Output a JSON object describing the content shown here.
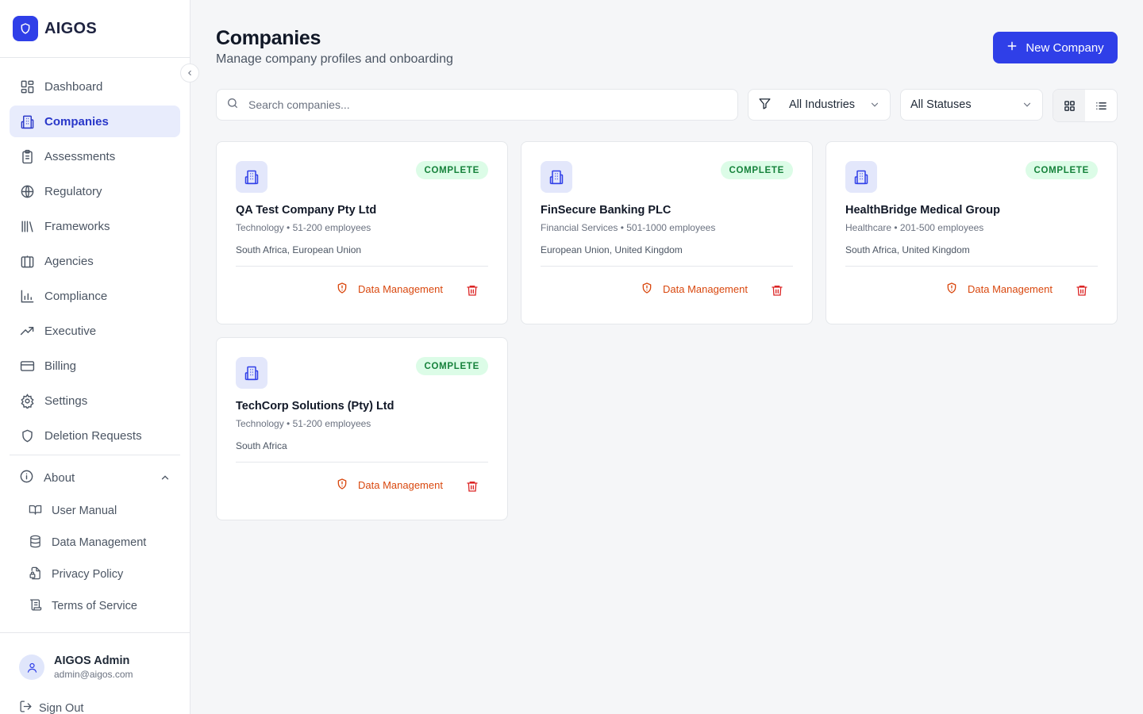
{
  "brand": {
    "name": "AIGOS",
    "color": "#2f3fe8"
  },
  "sidebar": {
    "items": [
      {
        "label": "Dashboard",
        "icon": "dashboard-icon"
      },
      {
        "label": "Companies",
        "icon": "building-icon",
        "active": true
      },
      {
        "label": "Assessments",
        "icon": "clipboard-icon"
      },
      {
        "label": "Regulatory",
        "icon": "globe-icon"
      },
      {
        "label": "Frameworks",
        "icon": "library-icon"
      },
      {
        "label": "Agencies",
        "icon": "landmark-icon"
      },
      {
        "label": "Compliance",
        "icon": "bar-chart-icon"
      },
      {
        "label": "Executive",
        "icon": "trending-up-icon"
      },
      {
        "label": "Billing",
        "icon": "credit-card-icon"
      },
      {
        "label": "Settings",
        "icon": "gear-icon"
      },
      {
        "label": "Deletion Requests",
        "icon": "shield-icon"
      }
    ],
    "about": {
      "label": "About",
      "items": [
        {
          "label": "User Manual",
          "icon": "book-icon"
        },
        {
          "label": "Data Management",
          "icon": "database-icon"
        },
        {
          "label": "Privacy Policy",
          "icon": "lock-file-icon"
        },
        {
          "label": "Terms of Service",
          "icon": "scroll-icon"
        }
      ]
    },
    "user": {
      "name": "AIGOS Admin",
      "email": "admin@aigos.com"
    },
    "sign_out": "Sign Out"
  },
  "header": {
    "title": "Companies",
    "subtitle": "Manage company profiles and onboarding",
    "new_button": "New Company"
  },
  "filters": {
    "search_placeholder": "Search companies...",
    "industry": "All Industries",
    "status": "All Statuses"
  },
  "companies": [
    {
      "name": "QA Test Company Pty Ltd",
      "meta": "Technology • 51-200 employees",
      "regions": "South Africa, European Union",
      "status": "COMPLETE",
      "action": "Data Management"
    },
    {
      "name": "FinSecure Banking PLC",
      "meta": "Financial Services • 501-1000 employees",
      "regions": "European Union, United Kingdom",
      "status": "COMPLETE",
      "action": "Data Management"
    },
    {
      "name": "HealthBridge Medical Group",
      "meta": "Healthcare • 201-500 employees",
      "regions": "South Africa, United Kingdom",
      "status": "COMPLETE",
      "action": "Data Management"
    },
    {
      "name": "TechCorp Solutions (Pty) Ltd",
      "meta": "Technology • 51-200 employees",
      "regions": "South Africa",
      "status": "COMPLETE",
      "action": "Data Management"
    }
  ],
  "colors": {
    "accent": "#2f3fe8",
    "success_bg": "#dcfce7",
    "success_text": "#16823b",
    "danger": "#d9480f"
  }
}
